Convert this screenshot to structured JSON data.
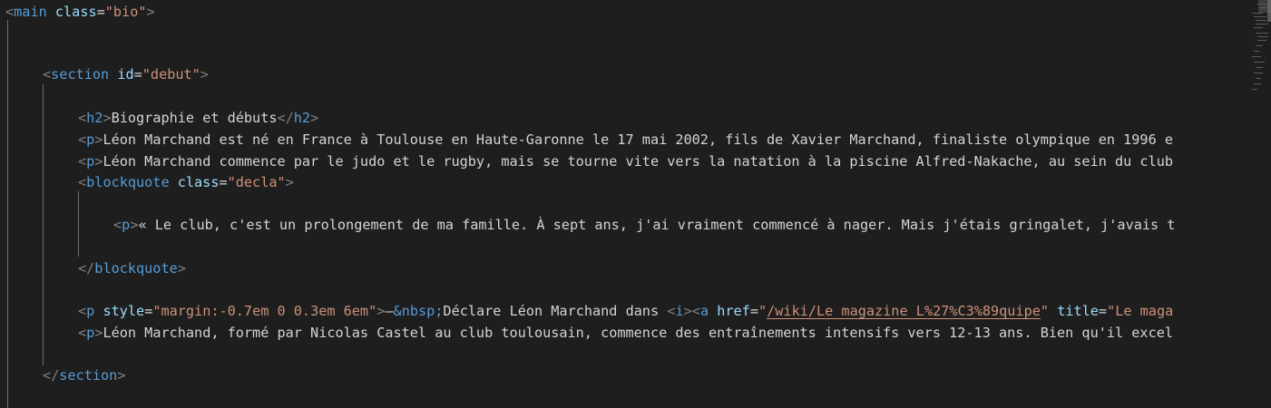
{
  "tokens": {
    "open_lt": "<",
    "gt": ">",
    "close_lt": "</",
    "eq": "=",
    "space": " "
  },
  "lines": {
    "main_open": {
      "tag": "main",
      "attr": "class",
      "value": "\"bio\""
    },
    "section_open": {
      "tag": "section",
      "attr": "id",
      "value": "\"debut\""
    },
    "h2": {
      "tag": "h2",
      "text": "Biographie et débuts"
    },
    "p1": {
      "tag": "p",
      "text": "Léon Marchand est né en France à Toulouse en Haute-Garonne le 17 mai 2002, fils de Xavier Marchand, finaliste olympique en 1996 e"
    },
    "p2": {
      "tag": "p",
      "text": "Léon Marchand commence par le judo et le rugby, mais se tourne vite vers la natation à la piscine Alfred-Nakache, au sein du club"
    },
    "blockquote_open": {
      "tag": "blockquote",
      "attr": "class",
      "value": "\"decla\""
    },
    "quote_p": {
      "tag": "p",
      "text": "« Le club, c'est un prolongement de ma famille. À sept ans, j'ai vraiment commencé à nager. Mais j'étais gringalet, j'avais t"
    },
    "blockquote_close": {
      "tag": "blockquote"
    },
    "p_style": {
      "tag": "p",
      "attr": "style",
      "value": "\"margin:-0.7em 0 0.3em 6em\"",
      "dash": "—",
      "entity": "&nbsp;",
      "text": "Déclare Léon Marchand dans ",
      "i_tag": "i",
      "a_tag": "a",
      "href_attr": "href",
      "href_value": "/wiki/Le_magazine_L%27%C3%89quipe",
      "quote": "\"",
      "title_attr": "title",
      "title_value": "\"Le maga"
    },
    "p3": {
      "tag": "p",
      "text": "Léon Marchand, formé par Nicolas Castel au club toulousain, commence des entraînements intensifs vers 12-13 ans. Bien qu'il excel"
    },
    "section_close": {
      "tag": "section"
    }
  },
  "colors": {
    "background": "#1e1e1e",
    "punctuation": "#808080",
    "tag": "#569cd6",
    "attribute": "#9cdcfe",
    "string": "#ce9178",
    "text": "#d4d4d4"
  }
}
